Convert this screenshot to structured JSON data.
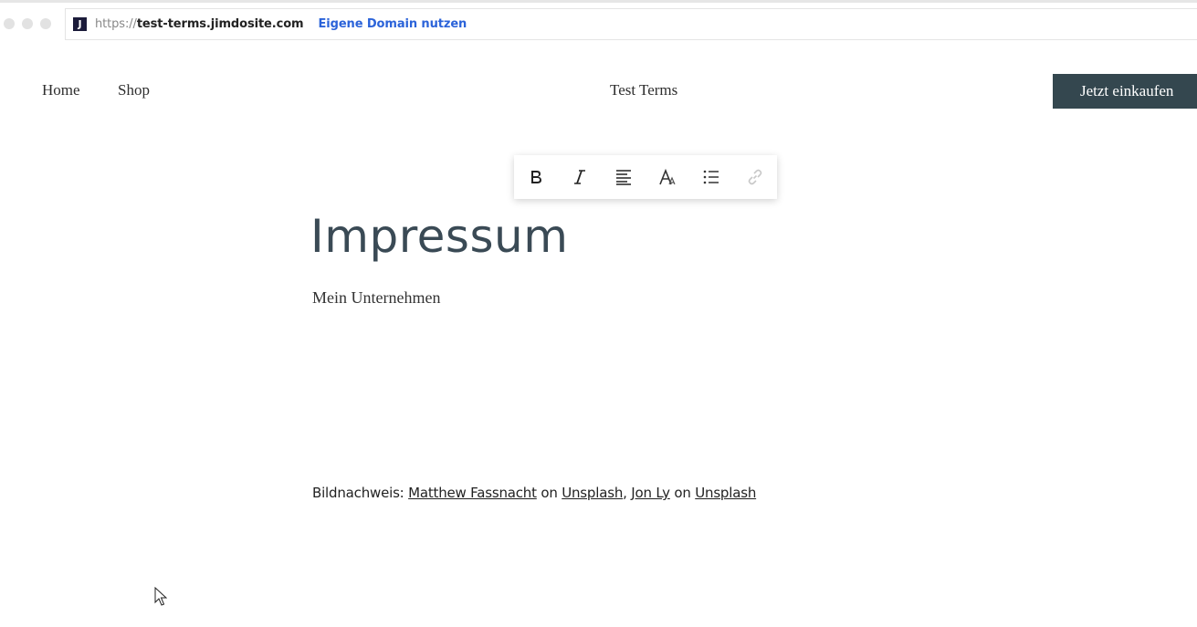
{
  "browser": {
    "url_scheme": "https://",
    "url_host": "test-terms.jimdosite.com",
    "logo_letter": "J",
    "custom_domain_link": "Eigene Domain nutzen"
  },
  "nav": {
    "items": [
      {
        "label": "Home"
      },
      {
        "label": "Shop"
      }
    ]
  },
  "site_title": "Test Terms",
  "cta_label": "Jetzt einkaufen",
  "toolbar": {
    "buttons": [
      "bold-icon",
      "italic-icon",
      "align-left-icon",
      "font-style-icon",
      "list-icon",
      "link-icon"
    ]
  },
  "content": {
    "title": "Impressum",
    "company": "Mein Unternehmen",
    "credits": {
      "prefix": "Bildnachweis: ",
      "author1": "Matthew Fassnacht",
      "on1": " on ",
      "source1": "Unsplash",
      "sep": ", ",
      "author2": "Jon Ly",
      "on2": " on ",
      "source2": "Unsplash"
    }
  },
  "colors": {
    "cta_bg": "#34474f",
    "link_blue": "#2b63d9",
    "title": "#3a4a55"
  }
}
